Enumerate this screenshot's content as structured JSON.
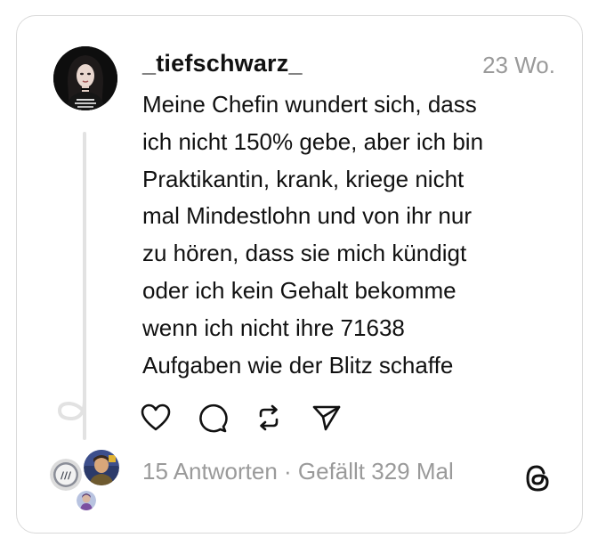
{
  "post": {
    "username": "_tiefschwarz_",
    "timestamp": "23 Wo.",
    "text_lines": [
      "Meine Chefin wundert sich, dass",
      "ich nicht 150% gebe, aber ich bin",
      "Praktikantin, krank, kriege nicht",
      "mal Mindestlohn und von ihr nur",
      "zu hören, dass sie mich kündigt",
      "oder ich kein Gehalt bekomme",
      "wenn ich nicht ihre 71638",
      "Aufgaben wie der Blitz schaffe"
    ]
  },
  "actions": {
    "like_icon": "heart-icon",
    "comment_icon": "comment-icon",
    "repost_icon": "repost-icon",
    "share_icon": "send-icon"
  },
  "stats": {
    "replies": "15 Antworten",
    "separator": " · ",
    "likes": "Gefällt 329 Mal"
  },
  "colors": {
    "text": "#111111",
    "muted": "#9a9a9a",
    "border": "#d9d9d9",
    "thread_line": "#e2e2e2"
  },
  "brand": {
    "logo_icon": "threads-logo-icon"
  }
}
